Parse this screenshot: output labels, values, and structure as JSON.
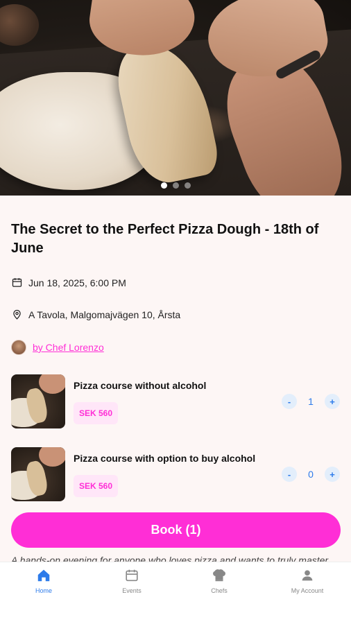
{
  "event": {
    "title": "The Secret to the Perfect Pizza Dough - 18th of June",
    "date": "Jun 18, 2025, 6:00 PM",
    "location": "A Tavola, Malgomajvägen 10, Årsta",
    "chef": "by Chef Lorenzo",
    "description": "A hands-on evening for anyone who loves pizza and wants to truly master"
  },
  "carousel": {
    "count": 3,
    "active": 0
  },
  "tickets": [
    {
      "name": "Pizza course without alcohol",
      "price": "SEK 560",
      "qty": "1"
    },
    {
      "name": "Pizza course with option to buy alcohol",
      "price": "SEK 560",
      "qty": "0"
    }
  ],
  "stepper": {
    "minus": "-",
    "plus": "+"
  },
  "book_button": "Book (1)",
  "nav": {
    "items": [
      {
        "label": "Home",
        "icon": "home-icon"
      },
      {
        "label": "Events",
        "icon": "calendar-icon"
      },
      {
        "label": "Chefs",
        "icon": "chef-hat-icon"
      },
      {
        "label": "My Account",
        "icon": "person-icon"
      }
    ],
    "active": "Home"
  },
  "colors": {
    "accent": "#ff2ed6",
    "nav_active": "#2d7bea",
    "background": "#fdf6f5"
  }
}
